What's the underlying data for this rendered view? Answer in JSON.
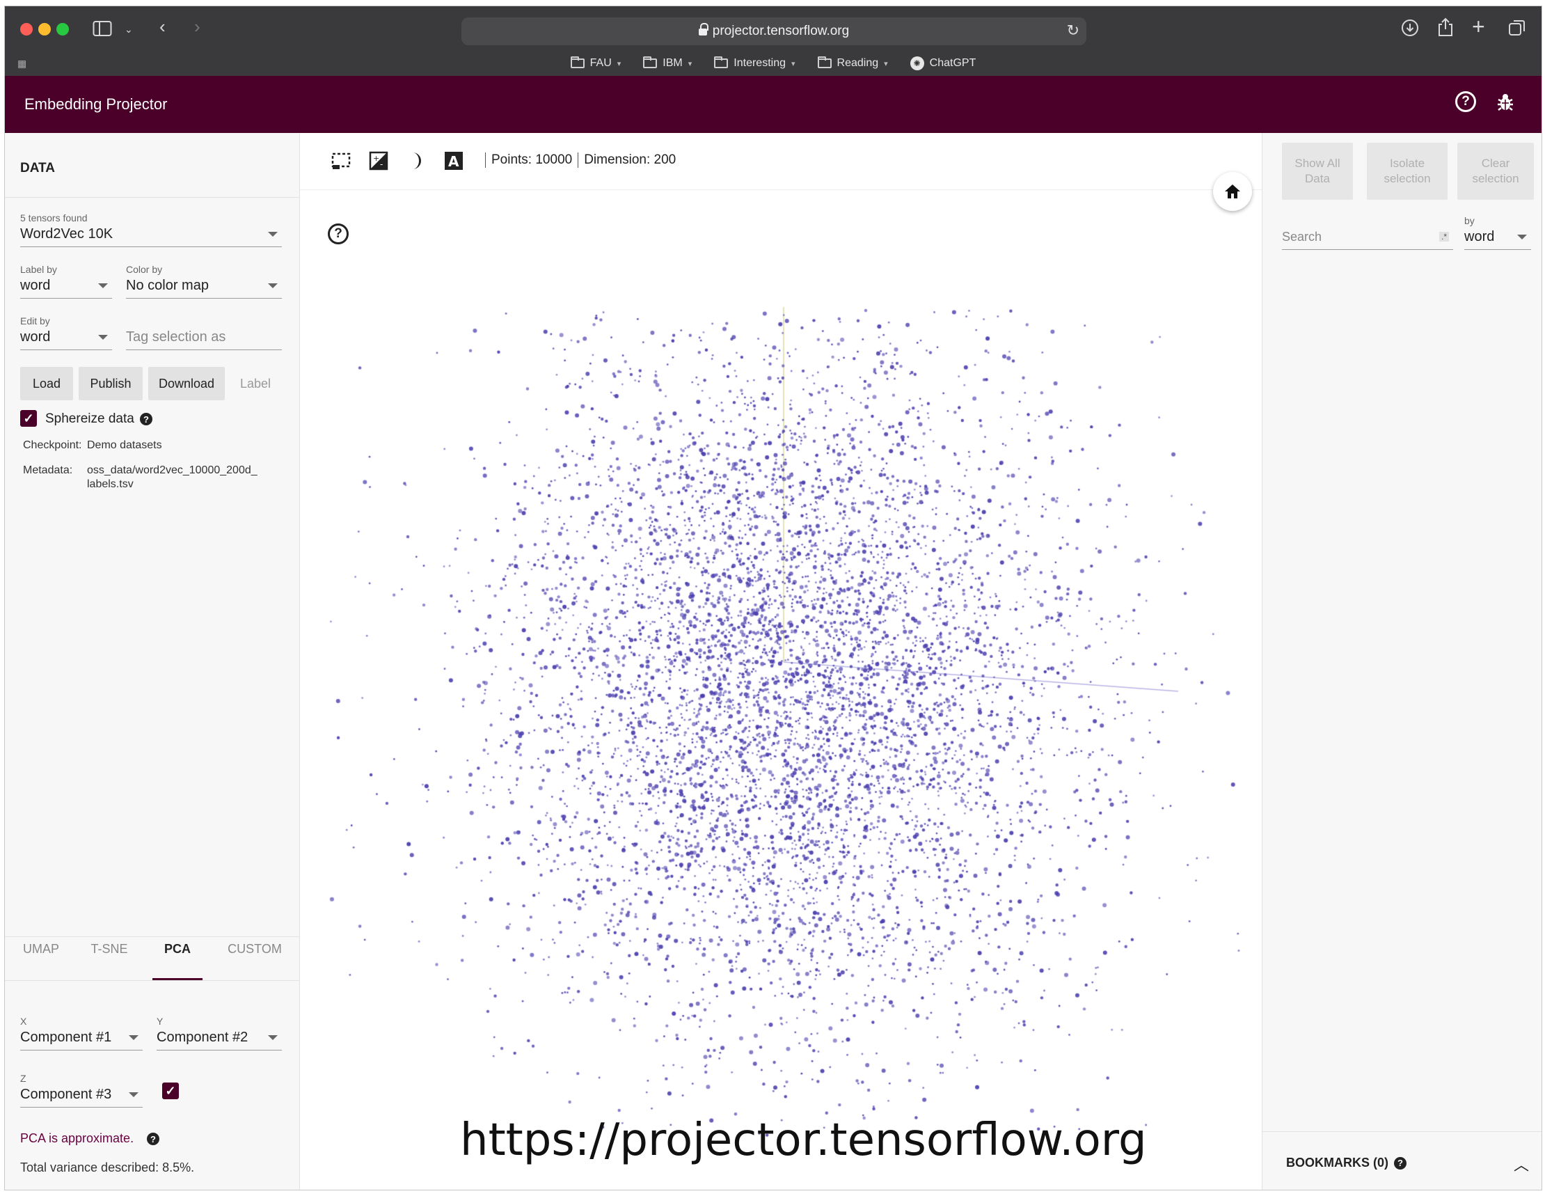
{
  "browser": {
    "url": "projector.tensorflow.org",
    "bookmarks": [
      {
        "label": "FAU"
      },
      {
        "label": "IBM"
      },
      {
        "label": "Interesting"
      },
      {
        "label": "Reading"
      },
      {
        "label": "ChatGPT"
      }
    ]
  },
  "app": {
    "title": "Embedding Projector",
    "header_color": "#4a0029"
  },
  "data_panel": {
    "heading": "DATA",
    "tensors_found": "5 tensors found",
    "tensor_selected": "Word2Vec 10K",
    "label_by_label": "Label by",
    "label_by_value": "word",
    "color_by_label": "Color by",
    "color_by_value": "No color map",
    "edit_by_label": "Edit by",
    "edit_by_value": "word",
    "tag_placeholder": "Tag selection as",
    "buttons": {
      "load": "Load",
      "publish": "Publish",
      "download": "Download",
      "label": "Label"
    },
    "sphereize_label": "Sphereize data",
    "checkpoint_label": "Checkpoint:",
    "checkpoint_value": "Demo datasets",
    "metadata_label": "Metadata:",
    "metadata_value_line1": "oss_data/word2vec_10000_200d_",
    "metadata_value_line2": "labels.tsv"
  },
  "projection": {
    "tabs": [
      "UMAP",
      "T-SNE",
      "PCA",
      "CUSTOM"
    ],
    "active_tab": "PCA",
    "x_label": "X",
    "x_value": "Component #1",
    "y_label": "Y",
    "y_value": "Component #2",
    "z_label": "Z",
    "z_value": "Component #3",
    "approx_note": "PCA is approximate.",
    "variance": "Total variance described: 8.5%."
  },
  "viewer": {
    "points_text": "Points: 10000",
    "dimension_text": "Dimension: 200",
    "point_color": "#4b3fae",
    "caption": "https://projector.tensorflow.org"
  },
  "inspector": {
    "show_all": "Show All Data",
    "isolate": "Isolate selection",
    "clear": "Clear selection",
    "search_placeholder": "Search",
    "by_label": "by",
    "by_value": "word",
    "bookmarks": "BOOKMARKS (0)"
  }
}
